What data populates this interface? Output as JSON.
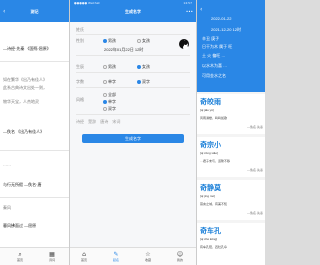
{
  "phone1": {
    "title": "测记",
    "lines": [
      "—诗经·先秦 《国殇·屈原》",
      "如在繁华《出乃有佳人》",
      "此系古典诗文出处一则，",
      "物华天宝，人杰地灵",
      "—佚名 《出乃有佳人》",
      "……",
      "与行无所假 —佚名·唐",
      "秦风",
      "暮风拂面过 —屈原"
    ],
    "tabs": [
      {
        "label": "首页",
        "icon": "⌕"
      },
      {
        "label": "诗词",
        "icon": "▦"
      }
    ]
  },
  "phone2": {
    "status_left": "●●●●● WeChat",
    "status_right": "14:57",
    "title": "生成名字",
    "fields": {
      "surname_label": "姓氏",
      "gender_label": "性别",
      "gender_options": [
        "男孩",
        "女孩"
      ],
      "birthday_label": "生辰",
      "birthday_value": "2022年01月22日 12时",
      "chars_label": "字数",
      "chars_options": [
        "单字",
        "双字"
      ],
      "style_label": "风格",
      "style_options": [
        "单字",
        "双字",
        "全部"
      ],
      "source_label": "来源",
      "source_options": [
        "诗经",
        "楚辞",
        "唐诗",
        "宋词"
      ]
    },
    "generate_label": "生成名字",
    "tabs": [
      {
        "label": "首页",
        "icon": "⌂"
      },
      {
        "label": "起名",
        "icon": "✎"
      },
      {
        "label": "收藏",
        "icon": "☆"
      },
      {
        "label": "我的",
        "icon": "☺"
      }
    ]
  },
  "phone3": {
    "header_lines": [
      "2022-01-22",
      "2021-12-20 12时",
      "辛丑 庚子",
      "日干为木 属于 旺",
      "土 火 偏旺 …",
      "以水木为喜 …",
      "可用金水之名"
    ],
    "names": [
      {
        "name": "奇皎雨",
        "pinyin": "[qí jiǎo yǔ]",
        "meaning": "风雨满楼，鸣鸣如歌",
        "source": "—佚名·先秦"
      },
      {
        "name": "奇宗小",
        "pinyin": "[qí zōng xiǎo]",
        "meaning": "…君子未与，道隆不移",
        "source": "—佚名·先秦"
      },
      {
        "name": "奇静莫",
        "pinyin": "[qí jìng mò]",
        "meaning": "莫言之城，有美不知",
        "source": "—佚名·先秦"
      },
      {
        "name": "奇车孔",
        "pinyin": "[qí chē kǒng]",
        "meaning": "有车孔阳，四牡孔阜",
        "source": ""
      }
    ]
  }
}
